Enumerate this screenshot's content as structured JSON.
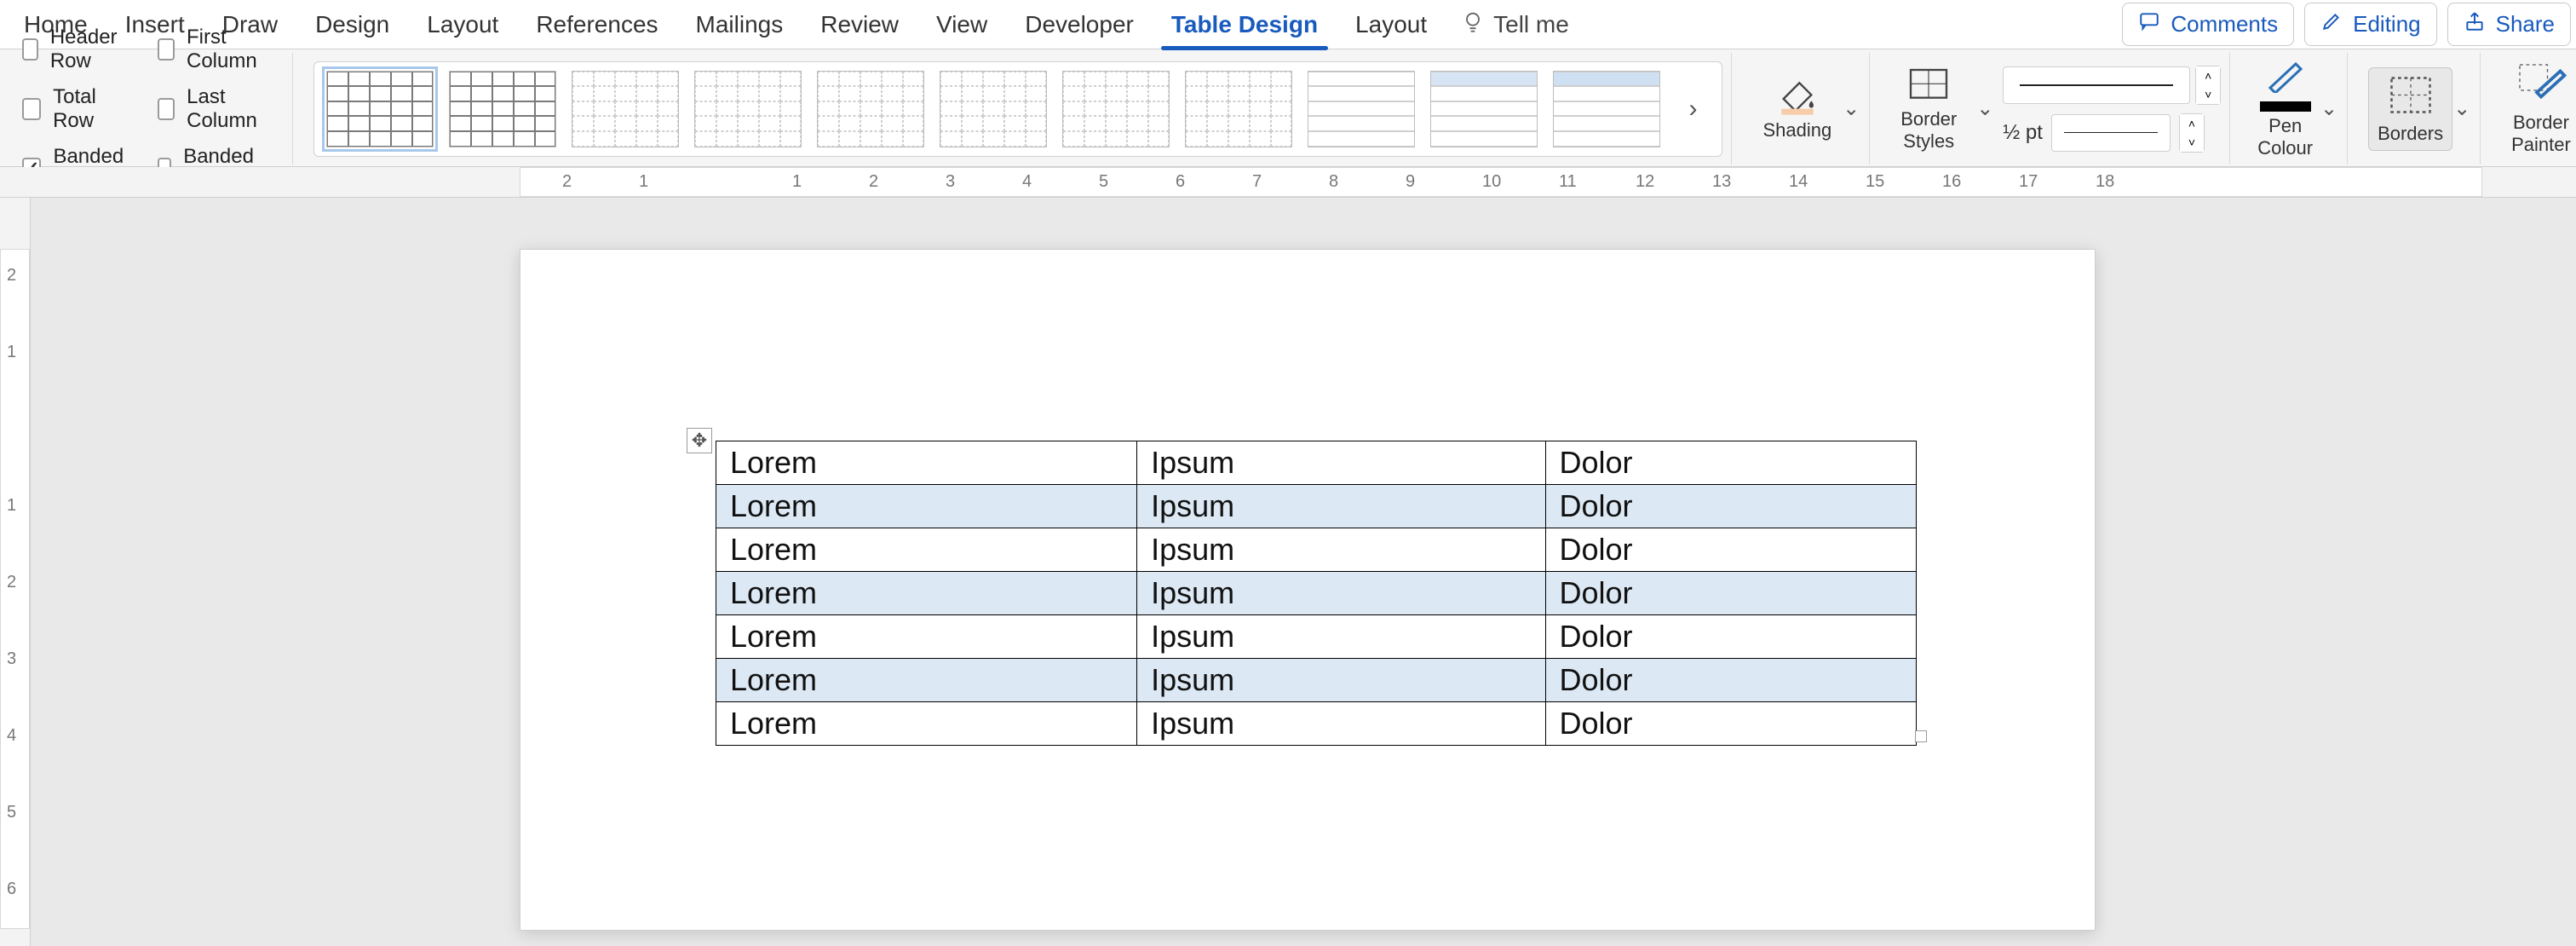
{
  "tabs": {
    "items": [
      "Home",
      "Insert",
      "Draw",
      "Design",
      "Layout",
      "References",
      "Mailings",
      "Review",
      "View",
      "Developer",
      "Table Design",
      "Layout"
    ],
    "activeIndex": 10,
    "tellMe": "Tell me"
  },
  "topRight": {
    "comments": "Comments",
    "editing": "Editing",
    "share": "Share"
  },
  "styleOptions": {
    "headerRow": {
      "label": "Header Row",
      "checked": false
    },
    "totalRow": {
      "label": "Total Row",
      "checked": false
    },
    "bandedRows": {
      "label": "Banded Rows",
      "checked": true
    },
    "firstColumn": {
      "label": "First Column",
      "checked": false
    },
    "lastColumn": {
      "label": "Last Column",
      "checked": false
    },
    "bandedCols": {
      "label": "Banded Columns",
      "checked": false
    }
  },
  "gallerySelectedIndex": 0,
  "shading": {
    "label": "Shading",
    "swatch": "#f6cda8"
  },
  "borderStyles": {
    "label": "Border\nStyles"
  },
  "lineWeight": {
    "label": "½ pt"
  },
  "penColour": {
    "label": "Pen\nColour",
    "swatch": "#000000"
  },
  "borders": {
    "label": "Borders"
  },
  "borderPainter": {
    "label": "Border\nPainter"
  },
  "rulerH": {
    "numbers": [
      2,
      1,
      "",
      1,
      2,
      3,
      4,
      5,
      6,
      7,
      8,
      9,
      10,
      11,
      12,
      13,
      14,
      15,
      16,
      17,
      18
    ]
  },
  "rulerV": {
    "numbers": [
      2,
      1,
      "",
      1,
      2,
      3,
      4,
      5,
      6
    ]
  },
  "tableData": {
    "rows": [
      [
        "Lorem",
        "Ipsum",
        "Dolor"
      ],
      [
        "Lorem",
        "Ipsum",
        "Dolor"
      ],
      [
        "Lorem",
        "Ipsum",
        "Dolor"
      ],
      [
        "Lorem",
        "Ipsum",
        "Dolor"
      ],
      [
        "Lorem",
        "Ipsum",
        "Dolor"
      ],
      [
        "Lorem",
        "Ipsum",
        "Dolor"
      ],
      [
        "Lorem",
        "Ipsum",
        "Dolor"
      ]
    ]
  }
}
